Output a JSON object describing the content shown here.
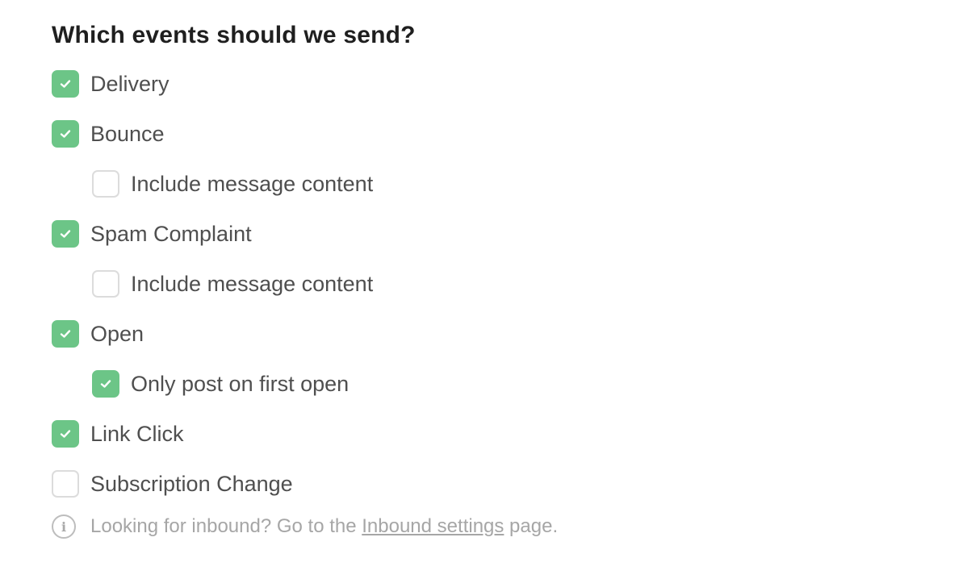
{
  "title": "Which events should we send?",
  "accent_color": "#6cc587",
  "events": [
    {
      "label": "Delivery",
      "checked": true,
      "sub": false
    },
    {
      "label": "Bounce",
      "checked": true,
      "sub": false
    },
    {
      "label": "Include message content",
      "checked": false,
      "sub": true
    },
    {
      "label": "Spam Complaint",
      "checked": true,
      "sub": false
    },
    {
      "label": "Include message content",
      "checked": false,
      "sub": true
    },
    {
      "label": "Open",
      "checked": true,
      "sub": false
    },
    {
      "label": "Only post on first open",
      "checked": true,
      "sub": true
    },
    {
      "label": "Link Click",
      "checked": true,
      "sub": false
    },
    {
      "label": "Subscription Change",
      "checked": false,
      "sub": false
    }
  ],
  "note": {
    "icon": "info-icon",
    "prefix": "Looking for inbound? Go to the ",
    "link_text": "Inbound settings",
    "suffix": " page."
  }
}
